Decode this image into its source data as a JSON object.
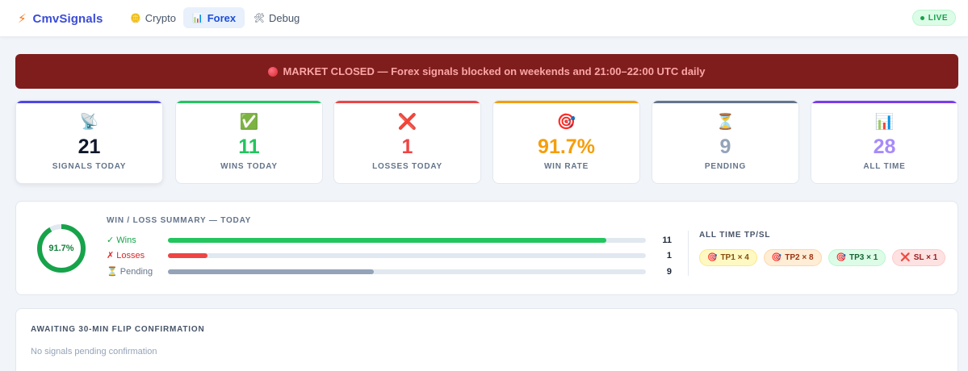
{
  "app": {
    "name": "CmvSignals",
    "logo_icon": "lightning-bolt-icon"
  },
  "nav": {
    "tabs": [
      {
        "label": "Crypto",
        "icon": "crypto-icon"
      },
      {
        "label": "Forex",
        "icon": "bar-chart-icon",
        "active": true
      },
      {
        "label": "Debug",
        "icon": "tools-icon"
      }
    ],
    "live_label": "LIVE"
  },
  "banner": {
    "text": "MARKET CLOSED — Forex signals blocked on weekends and 21:00–22:00 UTC daily",
    "color": "#7f1d1d"
  },
  "stats": [
    {
      "icon": "📡",
      "value": "21",
      "label": "SIGNALS TODAY",
      "color": "#0f172a",
      "accent": "#4f46e5"
    },
    {
      "icon": "✅",
      "value": "11",
      "label": "WINS TODAY",
      "color": "#22c55e",
      "accent": "#22c55e"
    },
    {
      "icon": "❌",
      "value": "1",
      "label": "LOSSES TODAY",
      "color": "#ef4444",
      "accent": "#ef4444"
    },
    {
      "icon": "🎯",
      "value": "91.7%",
      "label": "WIN RATE",
      "color": "#f59e0b",
      "accent": "#f59e0b"
    },
    {
      "icon": "⏳",
      "value": "9",
      "label": "PENDING",
      "color": "#94a3b8",
      "accent": "#64748b"
    },
    {
      "icon": "📊",
      "value": "28",
      "label": "ALL TIME",
      "color": "#a78bfa",
      "accent": "#7c3aed"
    }
  ],
  "summary": {
    "title": "WIN / LOSS SUMMARY — TODAY",
    "win_rate_label": "91.7%",
    "win_rate": 0.917,
    "rows": [
      {
        "label": "✓ Wins",
        "value": "11",
        "fraction": 0.917,
        "color": "#22c55e",
        "label_color": "#16a34a"
      },
      {
        "label": "✗ Losses",
        "value": "1",
        "fraction": 0.083,
        "color": "#ef4444",
        "label_color": "#dc2626"
      },
      {
        "label": "⏳ Pending",
        "value": "9",
        "fraction": 0.43,
        "color": "#94a3b8",
        "label_color": "#64748b"
      }
    ]
  },
  "all_time": {
    "title": "ALL TIME TP/SL",
    "badges": [
      {
        "icon": "🎯",
        "label": "TP1 × 4"
      },
      {
        "icon": "🎯",
        "label": "TP2 × 8"
      },
      {
        "icon": "🎯",
        "label": "TP3 × 1"
      },
      {
        "icon": "❌",
        "label": "SL × 1"
      }
    ]
  },
  "awaiting": {
    "title": "AWAITING 30-MIN FLIP CONFIRMATION",
    "empty_text": "No signals pending confirmation"
  }
}
